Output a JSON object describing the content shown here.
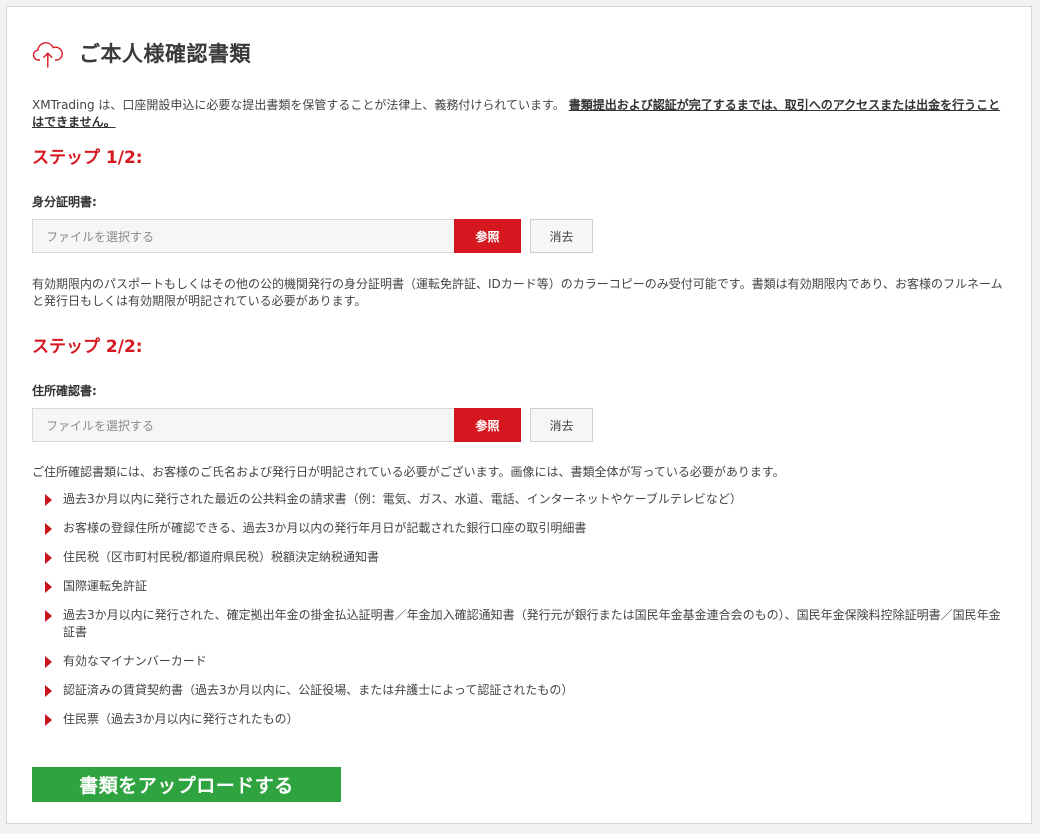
{
  "header": {
    "title": "ご本人様確認書類",
    "icon": "cloud-upload-icon"
  },
  "intro": {
    "text": "XMTrading は、口座開設申込に必要な提出書類を保管することが法律上、義務付けられています。",
    "emphasis": "書類提出および認証が完了するまでは、取引へのアクセスまたは出金を行うことはできません。"
  },
  "step1": {
    "title": "ステップ 1/2:",
    "label": "身分証明書:",
    "placeholder": "ファイルを選択する",
    "browse_label": "参照",
    "clear_label": "消去",
    "note": "有効期限内のパスポートもしくはその他の公的機関発行の身分証明書（運転免許証、IDカード等）のカラーコピーのみ受付可能です。書類は有効期限内であり、お客様のフルネームと発行日もしくは有効期限が明記されている必要があります。"
  },
  "step2": {
    "title": "ステップ 2/2:",
    "label": "住所確認書:",
    "placeholder": "ファイルを選択する",
    "browse_label": "参照",
    "clear_label": "消去",
    "note": "ご住所確認書類には、お客様のご氏名および発行日が明記されている必要がございます。画像には、書類全体が写っている必要があります。",
    "items": [
      "過去3か月以内に発行された最近の公共料金の請求書（例：電気、ガス、水道、電話、インターネットやケーブルテレビなど）",
      "お客様の登録住所が確認できる、過去3か月以内の発行年月日が記載された銀行口座の取引明細書",
      "住民税（区市町村民税/都道府県民税）税額決定納税通知書",
      "国際運転免許証",
      "過去3か月以内に発行された、確定拠出年金の掛金払込証明書／年金加入確認通知書（発行元が銀行または国民年金基金連合会のもの）、国民年金保険料控除証明書／国民年金証書",
      "有効なマイナンバーカード",
      "認証済みの賃貸契約書（過去3か月以内に、公証役場、または弁護士によって認証されたもの）",
      "住民票（過去3か月以内に発行されたもの）"
    ]
  },
  "upload": {
    "label": "書類をアップロードする"
  },
  "colors": {
    "accent_red": "#d51820",
    "upload_green": "#2ea33f"
  }
}
